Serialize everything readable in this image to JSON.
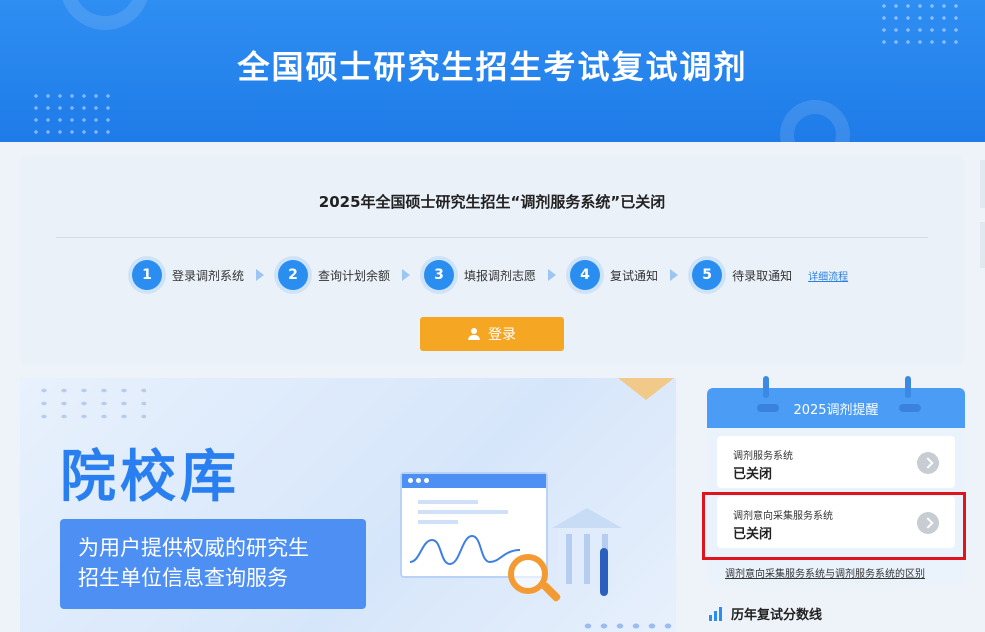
{
  "banner": {
    "title": "全国硕士研究生招生考试复试调剂"
  },
  "notice": {
    "text": "2025年全国硕士研究生招生“调剂服务系统”已关闭"
  },
  "steps": [
    {
      "num": "1",
      "label": "登录调剂系统"
    },
    {
      "num": "2",
      "label": "查询计划余额"
    },
    {
      "num": "3",
      "label": "填报调剂志愿"
    },
    {
      "num": "4",
      "label": "复试通知"
    },
    {
      "num": "5",
      "label": "待录取通知"
    }
  ],
  "detail_link": "详细流程",
  "login_button": "登录",
  "promo": {
    "title": "院校库",
    "subtitle_line1": "为用户提供权威的研究生",
    "subtitle_line2": "招生单位信息查询服务"
  },
  "reminder": {
    "title": "2025调剂提醒",
    "items": [
      {
        "label": "调剂服务系统",
        "status": "已关闭"
      },
      {
        "label": "调剂意向采集服务系统",
        "status": "已关闭"
      }
    ],
    "link": "调剂意向采集服务系统与调剂服务系统的区别"
  },
  "history": {
    "label": "历年复试分数线"
  },
  "colors": {
    "primary": "#2a8ef0",
    "accent": "#f5a623",
    "highlight": "#e0141b"
  },
  "icons": [
    "user-icon",
    "chevron-right-icon",
    "bar-chart-icon",
    "magnifier-icon"
  ]
}
